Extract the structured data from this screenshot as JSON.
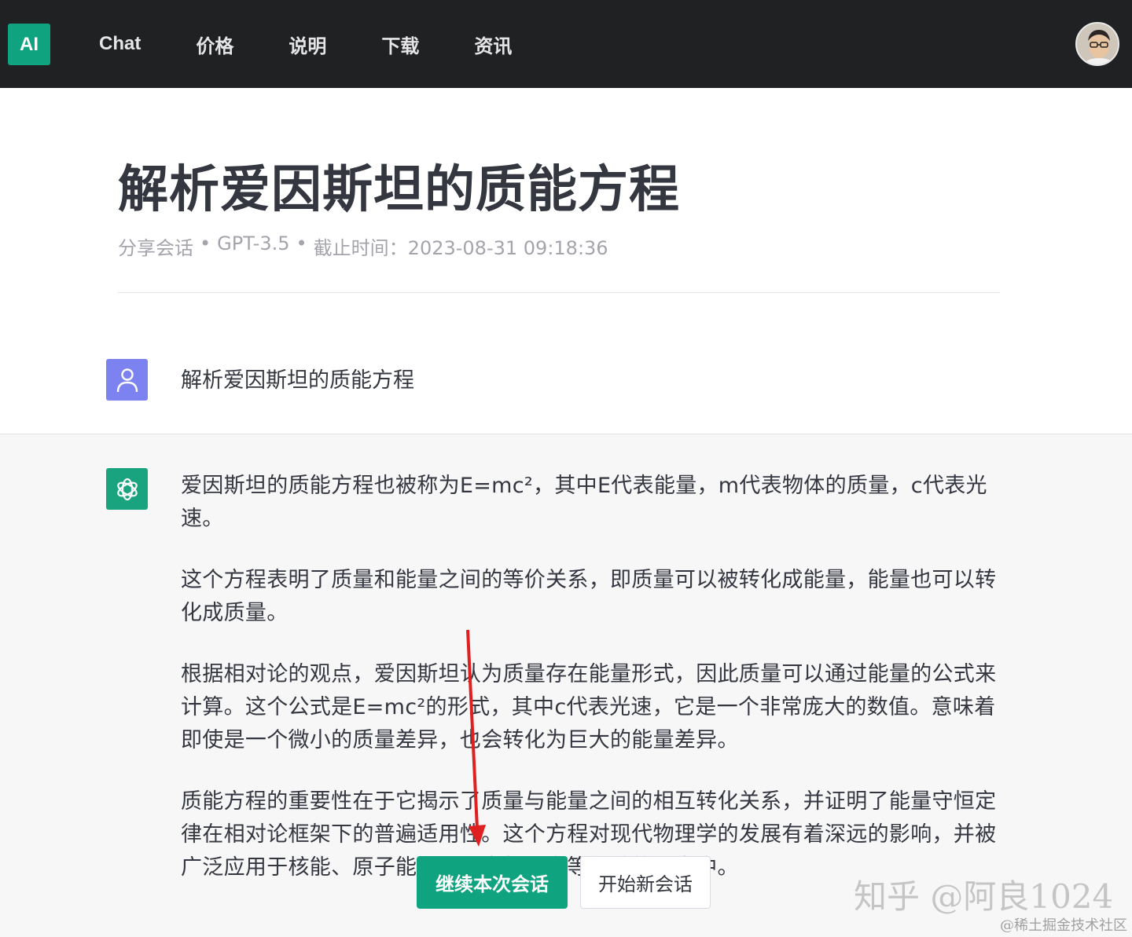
{
  "header": {
    "logo": "AI",
    "nav": [
      "Chat",
      "价格",
      "说明",
      "下载",
      "资讯"
    ],
    "avatar_icon": "user-avatar-photo"
  },
  "page": {
    "title": "解析爱因斯坦的质能方程",
    "meta": {
      "share": "分享会话",
      "sep1": "•",
      "model": "GPT-3.5",
      "sep2": "•",
      "deadline_label": "截止时间：",
      "deadline": "2023-08-31 09:18:36"
    }
  },
  "conversation": {
    "user_icon": "user-icon",
    "user_message": "解析爱因斯坦的质能方程",
    "assistant_icon": "openai-icon",
    "assistant_paragraphs": [
      "爱因斯坦的质能方程也被称为E=mc²，其中E代表能量，m代表物体的质量，c代表光速。",
      "这个方程表明了质量和能量之间的等价关系，即质量可以被转化成能量，能量也可以转化成质量。",
      "根据相对论的观点，爱因斯坦认为质量存在能量形式，因此质量可以通过能量的公式来计算。这个公式是E=mc²的形式，其中c代表光速，它是一个非常庞大的数值。意味着即使是一个微小的质量差异，也会转化为巨大的能量差异。",
      "质能方程的重要性在于它揭示了质量与能量之间的相互转化关系，并证明了能量守恒定律在相对论框架下的普遍适用性。这个方程对现代物理学的发展有着深远的影响，并被广泛应用于核能、原子能以及宇宙物理学等领域的研究中。"
    ]
  },
  "actions": {
    "continue_label": "继续本次会话",
    "new_label": "开始新会话"
  },
  "annotation": {
    "arrow_color": "#e02020"
  },
  "watermarks": {
    "main": "知乎 @阿良1024",
    "sub": "@稀土掘金技术社区"
  }
}
